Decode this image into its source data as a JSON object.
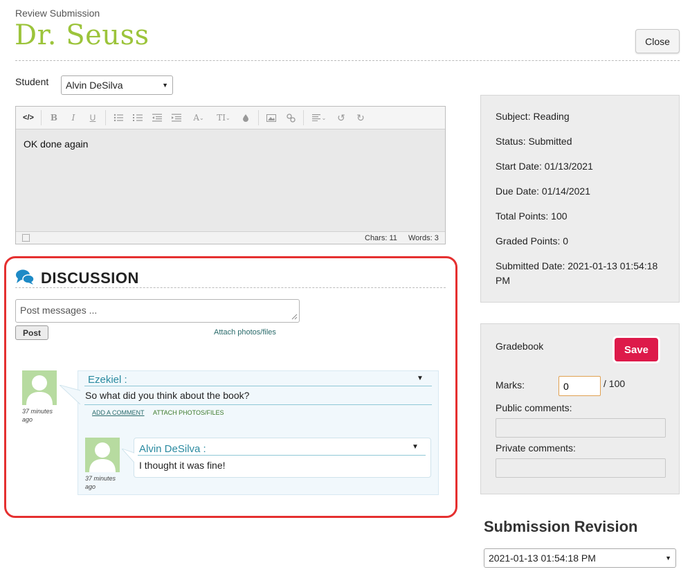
{
  "header": {
    "review_label": "Review Submission",
    "title": "Dr. Seuss",
    "close_label": "Close"
  },
  "student": {
    "label": "Student",
    "selected": "Alvin DeSilva"
  },
  "editor": {
    "content": "OK done again",
    "chars": "Chars: 11",
    "words": "Words: 3",
    "toolbar_icons": [
      "code-view-icon",
      "bold-icon",
      "italic-icon",
      "underline-icon",
      "bullet-list-icon",
      "numbered-list-icon",
      "outdent-icon",
      "indent-icon",
      "font-icon",
      "text-size-icon",
      "color-drop-icon",
      "image-icon",
      "link-icon",
      "align-icon",
      "undo-icon",
      "redo-icon"
    ]
  },
  "discussion": {
    "title": "DISCUSSION",
    "input_placeholder": "Post messages ...",
    "post_label": "Post",
    "attach_label": "Attach photos/files",
    "comments": [
      {
        "author": "Ezekiel :",
        "time": "37 minutes ago",
        "text": "So what did you think about the book?",
        "add_comment": "ADD A COMMENT",
        "attach": "ATTACH PHOTOS/FILES",
        "replies": [
          {
            "author": "Alvin DeSilva :",
            "time": "37 minutes ago",
            "text": "I thought it was fine!"
          }
        ]
      }
    ]
  },
  "info": {
    "subject": "Subject: Reading",
    "status": "Status: Submitted",
    "start_date": "Start Date: 01/13/2021",
    "due_date": "Due Date: 01/14/2021",
    "total_points": "Total Points: 100",
    "graded_points": "Graded Points: 0",
    "submitted_date": "Submitted Date: 2021-01-13 01:54:18 PM"
  },
  "gradebook": {
    "title": "Gradebook",
    "save_label": "Save",
    "marks_label": "Marks:",
    "marks_value": "0",
    "marks_total": "/ 100",
    "public_label": "Public comments:",
    "private_label": "Private comments:"
  },
  "revision": {
    "title": "Submission Revision",
    "selected": "2021-01-13 01:54:18 PM"
  },
  "colors": {
    "title_green": "#9cc43b",
    "save_red": "#dd1a4a",
    "highlight_red": "#e53030",
    "comment_blue": "#2a8aa0"
  }
}
